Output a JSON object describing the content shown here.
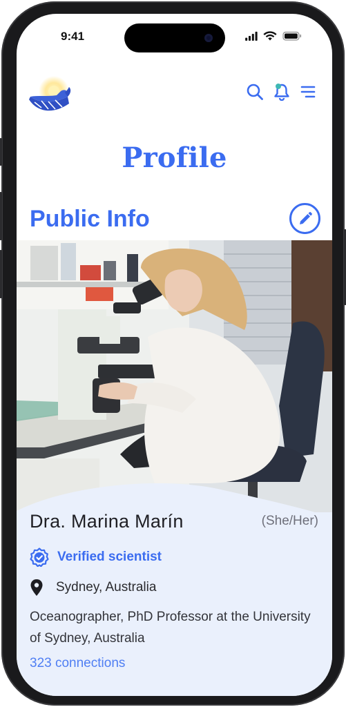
{
  "status_bar": {
    "time": "9:41"
  },
  "header": {
    "logo_icon": "whale-sun-logo",
    "search_icon": "search-icon",
    "notification_icon": "bell-icon",
    "menu_icon": "hamburger-menu-icon"
  },
  "page": {
    "title": "Profile"
  },
  "section": {
    "title": "Public Info",
    "edit_icon": "pencil-icon"
  },
  "profile": {
    "name": "Dra. Marina Marín",
    "pronouns": "(She/Her)",
    "verified_label": "Verified scientist",
    "location": "Sydney, Australia",
    "bio": "Oceanographer, PhD Professor at the University of Sydney, Australia",
    "connections": "323 connections"
  },
  "colors": {
    "accent": "#3b6cf0",
    "card_background": "#eaf0fc",
    "link": "#4f7ef3"
  }
}
